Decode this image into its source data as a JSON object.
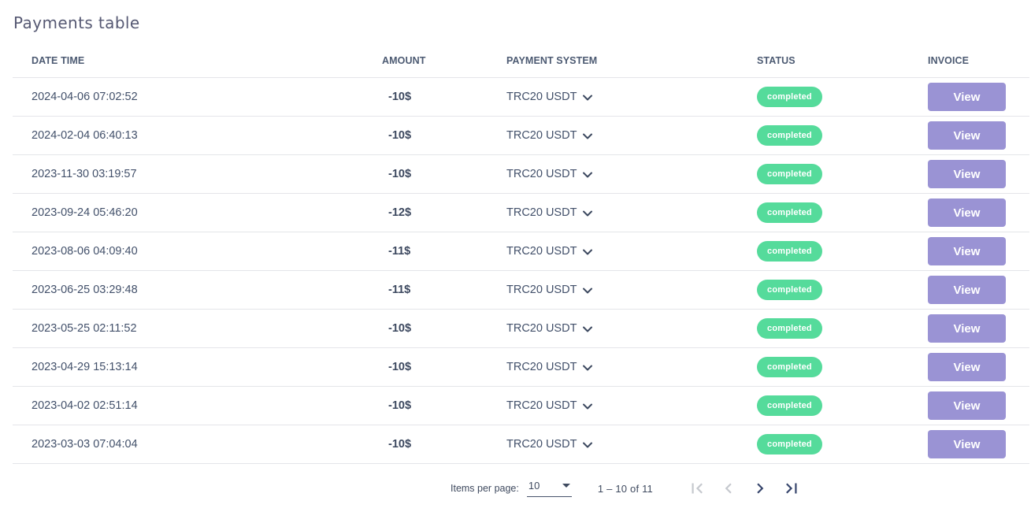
{
  "page": {
    "title": "Payments table"
  },
  "table": {
    "columns": {
      "date_time": "DATE TIME",
      "amount": "AMOUNT",
      "payment_system": "PAYMENT SYSTEM",
      "status": "STATUS",
      "invoice": "INVOICE"
    },
    "rows": [
      {
        "date_time": "2024-04-06 07:02:52",
        "amount": "-10$",
        "payment_system": "TRC20 USDT",
        "status": "completed",
        "invoice_action": "View"
      },
      {
        "date_time": "2024-02-04 06:40:13",
        "amount": "-10$",
        "payment_system": "TRC20 USDT",
        "status": "completed",
        "invoice_action": "View"
      },
      {
        "date_time": "2023-11-30 03:19:57",
        "amount": "-10$",
        "payment_system": "TRC20 USDT",
        "status": "completed",
        "invoice_action": "View"
      },
      {
        "date_time": "2023-09-24 05:46:20",
        "amount": "-12$",
        "payment_system": "TRC20 USDT",
        "status": "completed",
        "invoice_action": "View"
      },
      {
        "date_time": "2023-08-06 04:09:40",
        "amount": "-11$",
        "payment_system": "TRC20 USDT",
        "status": "completed",
        "invoice_action": "View"
      },
      {
        "date_time": "2023-06-25 03:29:48",
        "amount": "-11$",
        "payment_system": "TRC20 USDT",
        "status": "completed",
        "invoice_action": "View"
      },
      {
        "date_time": "2023-05-25 02:11:52",
        "amount": "-10$",
        "payment_system": "TRC20 USDT",
        "status": "completed",
        "invoice_action": "View"
      },
      {
        "date_time": "2023-04-29 15:13:14",
        "amount": "-10$",
        "payment_system": "TRC20 USDT",
        "status": "completed",
        "invoice_action": "View"
      },
      {
        "date_time": "2023-04-02 02:51:14",
        "amount": "-10$",
        "payment_system": "TRC20 USDT",
        "status": "completed",
        "invoice_action": "View"
      },
      {
        "date_time": "2023-03-03 07:04:04",
        "amount": "-10$",
        "payment_system": "TRC20 USDT",
        "status": "completed",
        "invoice_action": "View"
      }
    ]
  },
  "paginator": {
    "items_per_page_label": "Items per page:",
    "page_size": "10",
    "range_label": "1 – 10 of 11",
    "nav": [
      {
        "icon": "first-page-icon",
        "enabled": false
      },
      {
        "icon": "chevron-left-icon",
        "enabled": false
      },
      {
        "icon": "chevron-right-icon",
        "enabled": true
      },
      {
        "icon": "last-page-icon",
        "enabled": true
      }
    ]
  },
  "icons": {
    "payment_system_dropdown": "chevron-down",
    "page_size_dropdown": "caret-down"
  },
  "colors": {
    "badge_completed_bg": "#55db9b",
    "badge_completed_text": "#ffffff",
    "view_button_bg": "#9a93d4",
    "view_button_text": "#ffffff",
    "title_text": "#565973",
    "row_text": "#42506a",
    "divider": "#e4e5e9"
  }
}
